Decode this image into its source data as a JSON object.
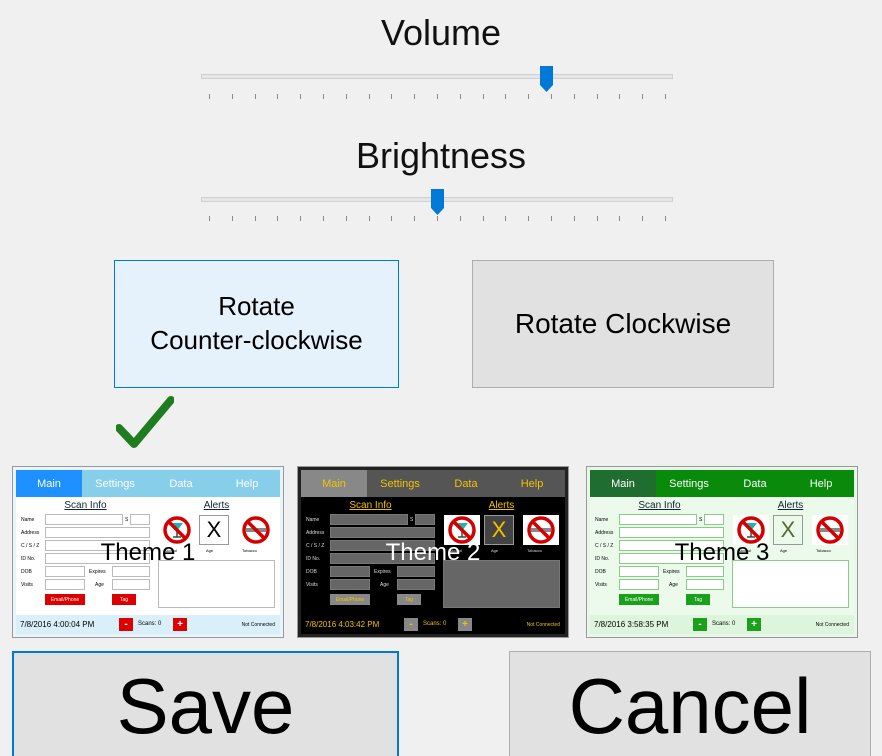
{
  "volume": {
    "label": "Volume",
    "level": 0.73
  },
  "brightness": {
    "label": "Brightness",
    "level": 0.5
  },
  "rotate": {
    "ccw_label_line1": "Rotate",
    "ccw_label_line2": "Counter-clockwise",
    "cw_label": "Rotate Clockwise"
  },
  "themes": [
    {
      "name": "Theme 1",
      "tabs": [
        "Main",
        "Settings",
        "Data",
        "Help"
      ],
      "scan_info": "Scan Info",
      "alerts": "Alerts",
      "fields": [
        "Name",
        "Address",
        "C / S / Z",
        "ID No.",
        "DOB",
        "Visits"
      ],
      "expires": "Expires",
      "age": "Age",
      "s": "S",
      "email_btn": "Email/Phone",
      "tag_btn": "Tag",
      "alert_labels": [
        "Alcohol",
        "Age",
        "Tobacco"
      ],
      "x": "X",
      "timestamp": "7/8/2016 4:00:04 PM",
      "minus": "-",
      "plus": "+",
      "scans": "Scans: 0",
      "connection": "Not Connected",
      "selected": true
    },
    {
      "name": "Theme 2",
      "tabs": [
        "Main",
        "Settings",
        "Data",
        "Help"
      ],
      "scan_info": "Scan Info",
      "alerts": "Alerts",
      "fields": [
        "Name",
        "Address",
        "C / S / Z",
        "ID No.",
        "DOB",
        "Visits"
      ],
      "expires": "Expires",
      "age": "Age",
      "s": "S",
      "email_btn": "Email/Phone",
      "tag_btn": "Tag",
      "alert_labels": [
        "Alcohol",
        "Age",
        "Tobacco"
      ],
      "x": "X",
      "timestamp": "7/8/2016 4:03:42 PM",
      "minus": "-",
      "plus": "+",
      "scans": "Scans: 0",
      "connection": "Not Connected",
      "selected": false
    },
    {
      "name": "Theme 3",
      "tabs": [
        "Main",
        "Settings",
        "Data",
        "Help"
      ],
      "scan_info": "Scan Info",
      "alerts": "Alerts",
      "fields": [
        "Name",
        "Address",
        "C / S / Z",
        "ID No.",
        "DOB",
        "Visits"
      ],
      "expires": "Expires",
      "age": "Age",
      "s": "S",
      "email_btn": "Email/Phone",
      "tag_btn": "Tag",
      "alert_labels": [
        "Alcohol",
        "Age",
        "Tobacco"
      ],
      "x": "X",
      "timestamp": "7/8/2016 3:58:35 PM",
      "minus": "-",
      "plus": "+",
      "scans": "Scans: 0",
      "connection": "Not Connected",
      "selected": false
    }
  ],
  "actions": {
    "save_label": "Save",
    "cancel_label": "Cancel"
  },
  "colors": {
    "accent": "#0078d7",
    "check": "#1e7d1e"
  },
  "icons": {
    "selected_marker": "checkmark-icon",
    "alert_alcohol": "no-alcohol-icon",
    "alert_tobacco": "no-smoking-icon"
  }
}
